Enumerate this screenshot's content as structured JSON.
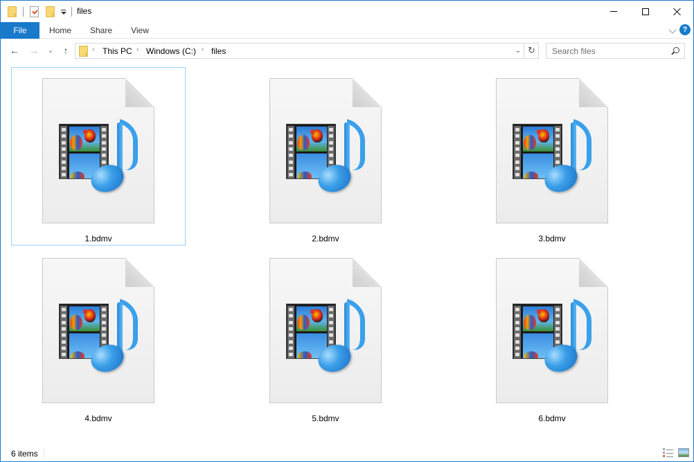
{
  "window": {
    "title": "files",
    "controls": {
      "minimize": "minimize",
      "maximize": "maximize",
      "close": "close"
    }
  },
  "quick_access": {
    "icons": [
      "folder-icon",
      "properties-icon",
      "new-folder-icon",
      "customize-dropdown-icon"
    ]
  },
  "ribbon": {
    "tabs": [
      {
        "label": "File",
        "active": true
      },
      {
        "label": "Home"
      },
      {
        "label": "Share"
      },
      {
        "label": "View"
      }
    ],
    "help": "?"
  },
  "nav": {
    "back": "←",
    "forward": "→",
    "recent": "⌄",
    "up": "↑",
    "breadcrumb": [
      "This PC",
      "Windows (C:)",
      "files"
    ],
    "separator": "›",
    "dropdown": "⌄",
    "refresh": "↻"
  },
  "search": {
    "placeholder": "Search files",
    "value": ""
  },
  "files": [
    {
      "name": "1.bdmv",
      "selected": true
    },
    {
      "name": "2.bdmv"
    },
    {
      "name": "3.bdmv"
    },
    {
      "name": "4.bdmv"
    },
    {
      "name": "5.bdmv"
    },
    {
      "name": "6.bdmv"
    }
  ],
  "status": {
    "item_count": "6 items"
  },
  "colors": {
    "accent": "#1979ca",
    "selection_border": "#99d1ff"
  }
}
